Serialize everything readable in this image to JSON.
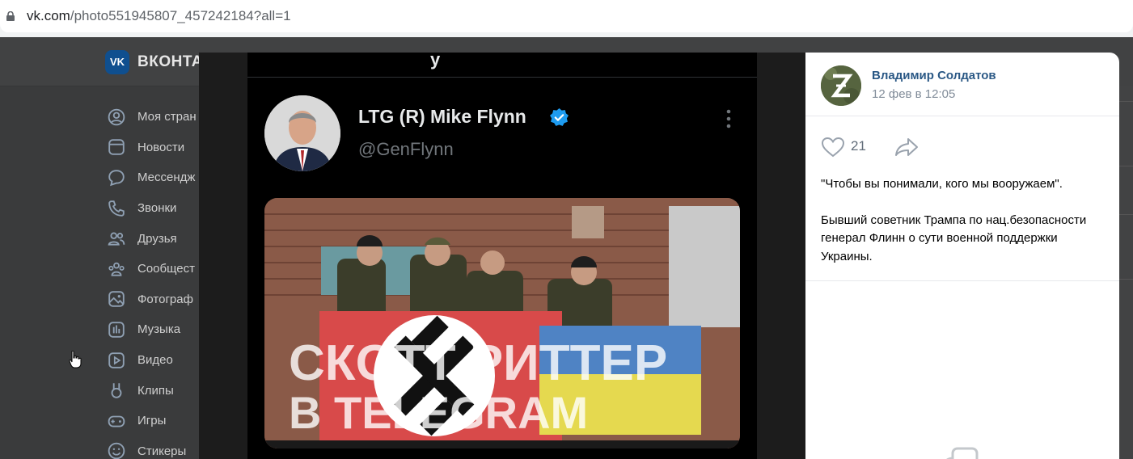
{
  "browser": {
    "url_host": "vk.com",
    "url_path": "/photo551945807_457242184?all=1"
  },
  "vk": {
    "brand": "ВКОНТА",
    "menu": [
      {
        "label": "Моя стран",
        "icon": "user-circle-icon"
      },
      {
        "label": "Новости",
        "icon": "news-icon"
      },
      {
        "label": "Мессендж",
        "icon": "message-icon"
      },
      {
        "label": "Звонки",
        "icon": "phone-icon"
      },
      {
        "label": "Друзья",
        "icon": "friends-icon"
      },
      {
        "label": "Сообщест",
        "icon": "communities-icon"
      },
      {
        "label": "Фотограф",
        "icon": "photo-icon"
      },
      {
        "label": "Музыка",
        "icon": "music-icon"
      },
      {
        "label": "Видео",
        "icon": "video-icon"
      },
      {
        "label": "Клипы",
        "icon": "clips-icon"
      },
      {
        "label": "Игры",
        "icon": "games-icon"
      },
      {
        "label": "Стикеры",
        "icon": "stickers-icon"
      }
    ]
  },
  "tweet": {
    "name": "LTG (R) Mike Flynn",
    "handle": "@GenFlynn",
    "top_fragment": "y"
  },
  "post": {
    "author": "Владимир Солдатов",
    "date": "12 фев в 12:05",
    "likes": "21",
    "text_line1": "\"Чтобы вы понимали, кого мы вооружаем\".",
    "text_line2": "Бывший советник Трампа по нац.безопасности генерал Флинн о сути военной поддержки Украины."
  }
}
